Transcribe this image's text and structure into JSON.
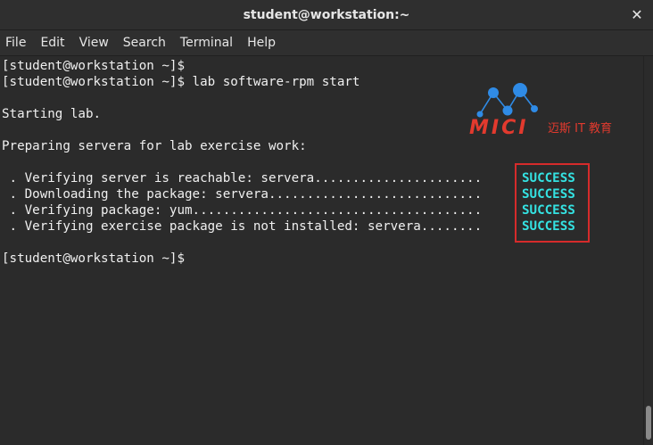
{
  "window": {
    "title": "student@workstation:~",
    "close_glyph": "✕"
  },
  "menu": {
    "items": [
      "File",
      "Edit",
      "View",
      "Search",
      "Terminal",
      "Help"
    ]
  },
  "terminal": {
    "lines": [
      "[student@workstation ~]$",
      "[student@workstation ~]$ lab software-rpm start",
      "",
      "Starting lab.",
      "",
      "Preparing servera for lab exercise work:",
      "",
      " . Verifying server is reachable: servera......................",
      " . Downloading the package: servera............................",
      " . Verifying package: yum......................................",
      " . Verifying exercise package is not installed: servera........",
      "",
      "[student@workstation ~]$"
    ],
    "statuses": [
      "SUCCESS",
      "SUCCESS",
      "SUCCESS",
      "SUCCESS"
    ],
    "colors": {
      "background": "#2b2b2b",
      "foreground": "#f0f0f0",
      "success": "#34e2e2",
      "highlight_border": "#d62b2b"
    }
  },
  "watermark": {
    "brand": "MICI",
    "tagline": "迈斯 IT 教育",
    "color": "#e23a2e",
    "dot_color": "#2f8be6"
  }
}
